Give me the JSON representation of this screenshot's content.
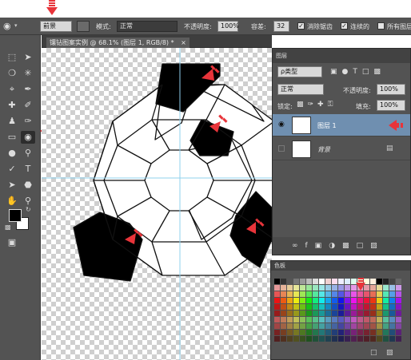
{
  "options_bar": {
    "fill_source": "前景",
    "mode_label": "模式:",
    "mode_value": "正常",
    "opacity_label": "不透明度:",
    "opacity_value": "100%",
    "tolerance_label": "容差:",
    "tolerance_value": "32",
    "antialias_label": "消除锯齿",
    "contiguous_label": "连续的",
    "all_layers_label": "所有图层"
  },
  "document": {
    "tab_title": "镶钻图案实例 @ 68.1% (图层 1, RGB/8) *",
    "close_glyph": "×"
  },
  "layers_panel": {
    "title": "图层",
    "filter_kind": "ρ类型",
    "blend_mode": "正常",
    "opacity_label": "不透明度:",
    "opacity_value": "100%",
    "lock_label": "锁定:",
    "fill_label": "填充:",
    "fill_value": "100%",
    "layers": [
      {
        "name": "图层 1",
        "selected": true,
        "visible": true
      },
      {
        "name": "背景",
        "selected": false,
        "visible": false,
        "locked": true
      }
    ]
  },
  "swatches_panel": {
    "title": "色板"
  },
  "colors": {
    "accent_arrow": "#e8343a",
    "layer_selected": "#6f8fb0",
    "panel_bg": "#535353"
  },
  "icons": [
    "paint-bucket-icon",
    "marquee-icon",
    "lasso-icon",
    "crop-icon",
    "brush-icon",
    "eraser-icon",
    "pen-icon",
    "type-icon",
    "hand-icon",
    "zoom-icon",
    "eye-icon",
    "lock-icon",
    "link-icon",
    "fx-icon",
    "mask-icon",
    "folder-icon",
    "new-layer-icon",
    "trash-icon"
  ]
}
